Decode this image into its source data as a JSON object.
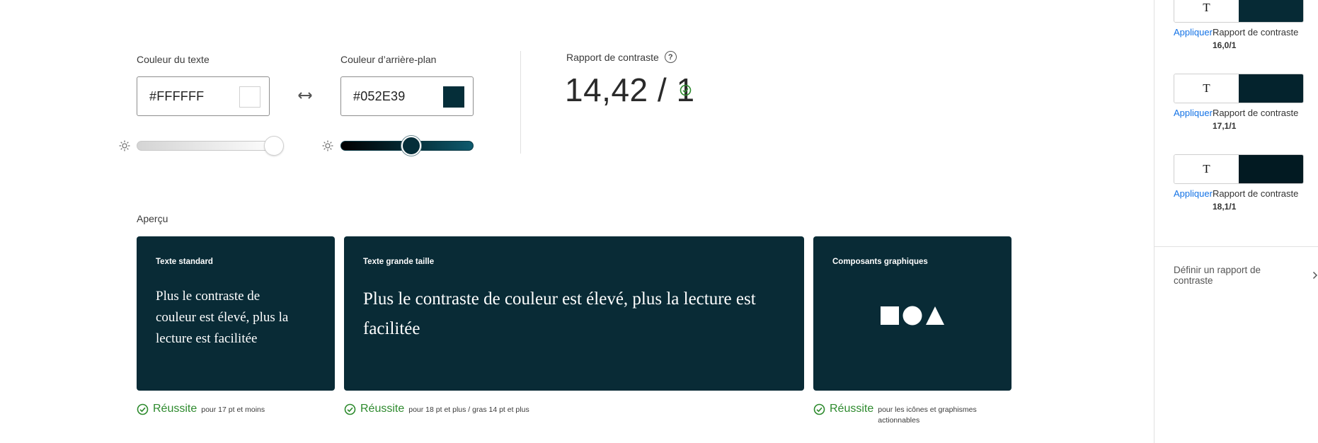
{
  "text_color": {
    "label": "Couleur du texte",
    "hex": "#FFFFFF",
    "swatch": "#FFFFFF"
  },
  "background_color": {
    "label": "Couleur d’arrière-plan",
    "hex": "#052E39",
    "swatch": "#052E39"
  },
  "contrast": {
    "label": "Rapport de contraste",
    "help": "?",
    "value": "14,42 / 1"
  },
  "preview": {
    "label": "Aperçu",
    "card_bg": "#092B36",
    "card_fg": "#FFFFFF",
    "cards": [
      {
        "title": "Texte standard",
        "text": "Plus le contraste de couleur est élevé, plus la lecture est facilitée"
      },
      {
        "title": "Texte grande taille",
        "text": "Plus le contraste de couleur est élevé, plus la lecture est facilitée"
      },
      {
        "title": "Composants graphiques"
      }
    ],
    "results": [
      {
        "status": "Réussite",
        "note": "pour 17 pt et moins"
      },
      {
        "status": "Réussite",
        "note": "pour 18 pt et plus / gras 14 pt et plus"
      },
      {
        "status": "Réussite",
        "note": "pour les icônes et graphismes actionnables"
      }
    ]
  },
  "colors": {
    "pass": "#2D8A2D",
    "link": "#1473E6"
  },
  "sidebar": {
    "suggestions": [
      {
        "t": "T",
        "swatch": "#062A35",
        "apply": "Appliquer",
        "ratio_label": "Rapport de contraste",
        "ratio": "16,0/1"
      },
      {
        "t": "T",
        "swatch": "#04232D",
        "apply": "Appliquer",
        "ratio_label": "Rapport de contraste",
        "ratio": "17,1/1"
      },
      {
        "t": "T",
        "swatch": "#021A22",
        "apply": "Appliquer",
        "ratio_label": "Rapport de contraste",
        "ratio": "18,1/1"
      }
    ],
    "define": "Définir un rapport de contraste"
  }
}
